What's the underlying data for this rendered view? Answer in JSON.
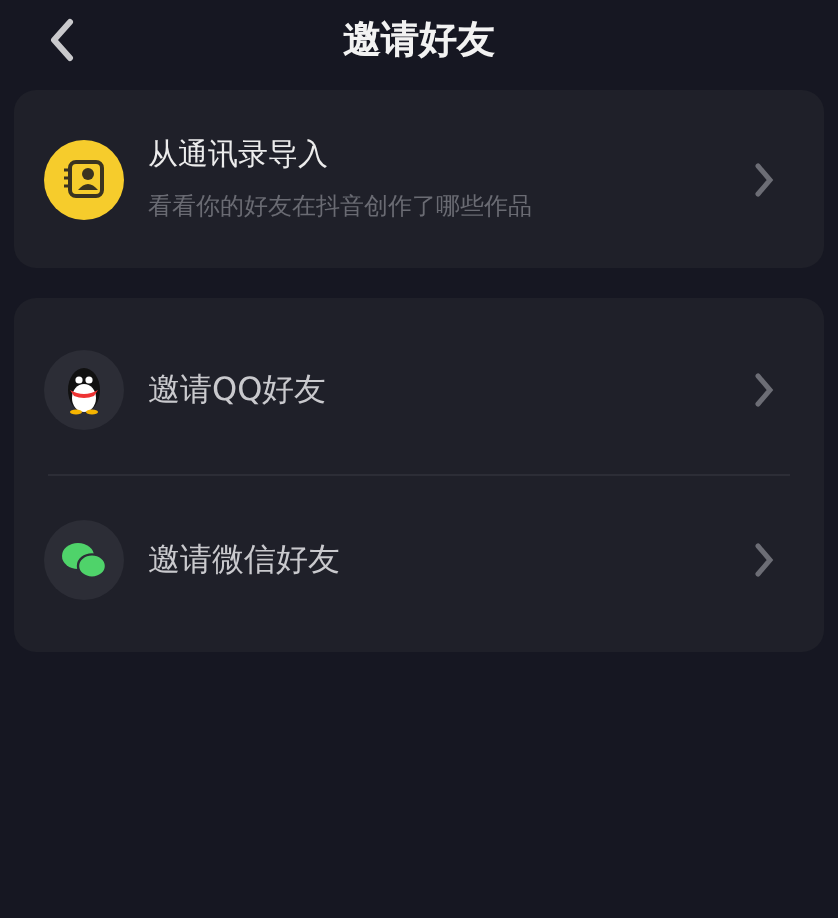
{
  "header": {
    "title": "邀请好友"
  },
  "import_card": {
    "title": "从通讯录导入",
    "subtitle": "看看你的好友在抖音创作了哪些作品"
  },
  "invite_items": [
    {
      "kind": "qq",
      "label": "邀请QQ好友"
    },
    {
      "kind": "wechat",
      "label": "邀请微信好友"
    }
  ]
}
